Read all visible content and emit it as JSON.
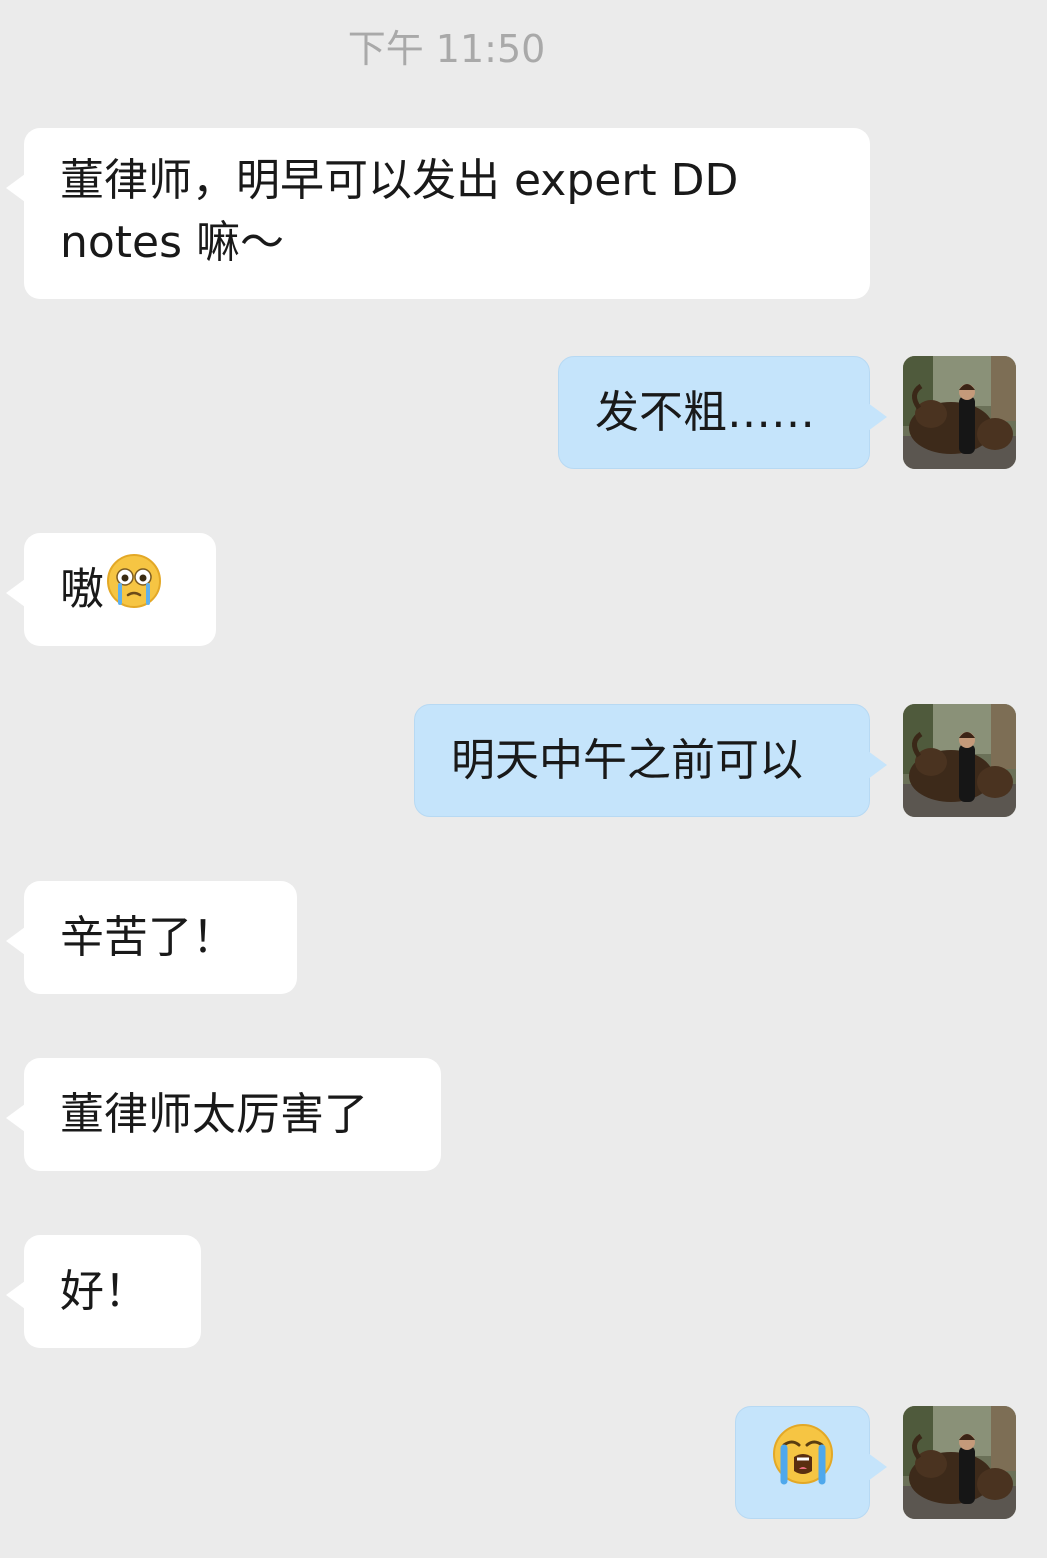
{
  "timestamp": "下午 11:50",
  "messages": [
    {
      "side": "left",
      "line1": "董律师，明早可以发出 expert DD",
      "line2": "notes 嘛～"
    },
    {
      "side": "right",
      "text": "发不粗……"
    },
    {
      "side": "left",
      "text": "嗷",
      "emoji": "crying-face-emoji"
    },
    {
      "side": "right",
      "text": "明天中午之前可以"
    },
    {
      "side": "left",
      "text": "辛苦了！"
    },
    {
      "side": "left",
      "text": "董律师太厉害了"
    },
    {
      "side": "left",
      "text": "好！"
    },
    {
      "side": "right",
      "text": "",
      "emoji": "loudly-crying-emoji"
    }
  ],
  "colors": {
    "background": "#ebebeb",
    "left_bubble": "#ffffff",
    "right_bubble": "#c5e4fb",
    "timestamp_text": "#a9a9a9"
  },
  "avatar": {
    "icon": "user-avatar-photo"
  }
}
